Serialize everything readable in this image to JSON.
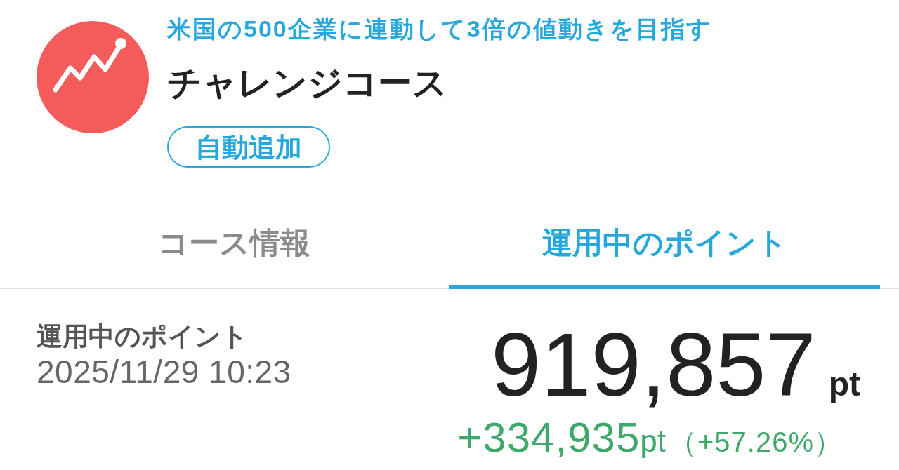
{
  "course": {
    "tagline": "米国の500企業に連動して3倍の値動きを目指す",
    "name": "チャレンジコース",
    "tag": "自動追加"
  },
  "tabs": [
    {
      "label": "コース情報",
      "selected": false
    },
    {
      "label": "運用中のポイント",
      "selected": true
    }
  ],
  "points": {
    "label": "運用中のポイント",
    "timestamp": "2025/11/29 10:23",
    "value": "919,857",
    "unit": "pt",
    "change": {
      "value": "+334,935",
      "unit": "pt",
      "percent": "（+57.26%）",
      "gain": true
    }
  }
}
